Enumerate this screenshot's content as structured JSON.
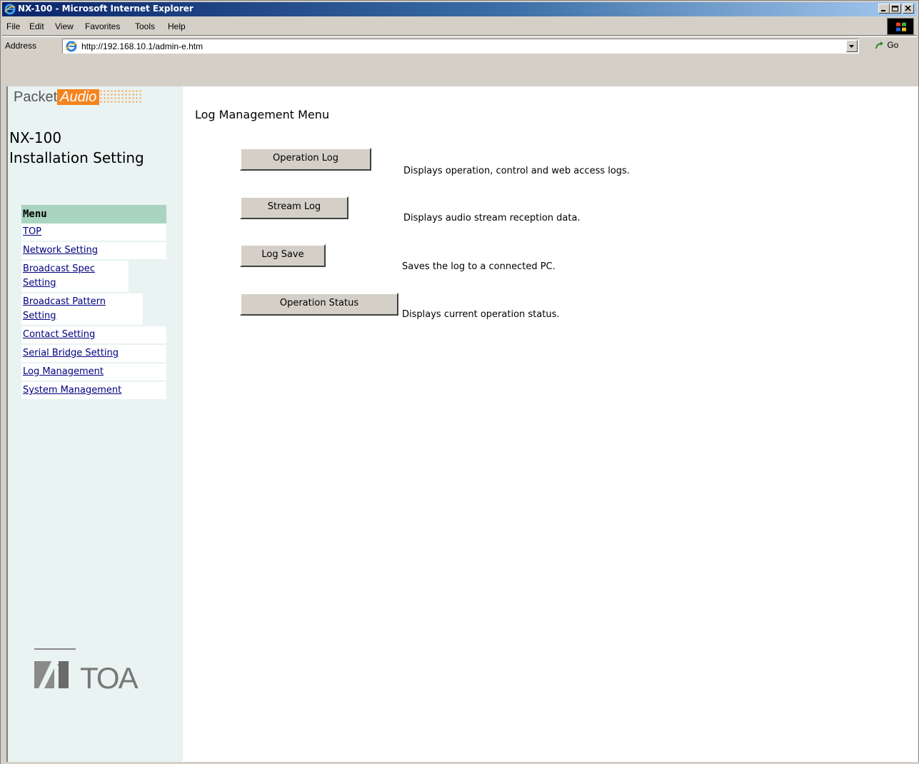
{
  "window": {
    "title": "NX-100 - Microsoft Internet Explorer",
    "icon": "ie-icon"
  },
  "menubar": {
    "items": [
      "File",
      "Edit",
      "View",
      "Favorites",
      "Tools",
      "Help"
    ]
  },
  "addressbar": {
    "label": "Address",
    "url": "http://192.168.10.1/admin-e.htm",
    "go_label": "Go"
  },
  "sidebar": {
    "logo_packet": "Packet",
    "logo_audio": "Audio",
    "product_line1": "NX-100",
    "product_line2": "Installation Setting",
    "menu_title": "Menu",
    "menu_items": [
      "TOP",
      "Network Setting",
      "Broadcast Spec Setting",
      "Broadcast Pattern Setting",
      "Contact Setting",
      "Serial Bridge Setting",
      "Log Management",
      "System Management"
    ],
    "brand": "TOA"
  },
  "main": {
    "title": "Log Management Menu",
    "actions": [
      {
        "label": "Operation Log",
        "desc": "Displays operation, control and web access logs."
      },
      {
        "label": "Stream Log",
        "desc": "Displays audio stream reception data."
      },
      {
        "label": "Log Save",
        "desc": "Saves the log to a connected PC."
      },
      {
        "label": "Operation Status",
        "desc": "Displays current operation status."
      }
    ]
  },
  "colors": {
    "titlebar_start": "#0a246a",
    "sidebar_bg": "#e8f3f2",
    "menu_header": "#a8d4c0",
    "logo_orange": "#f5841f",
    "link": "#000080"
  }
}
